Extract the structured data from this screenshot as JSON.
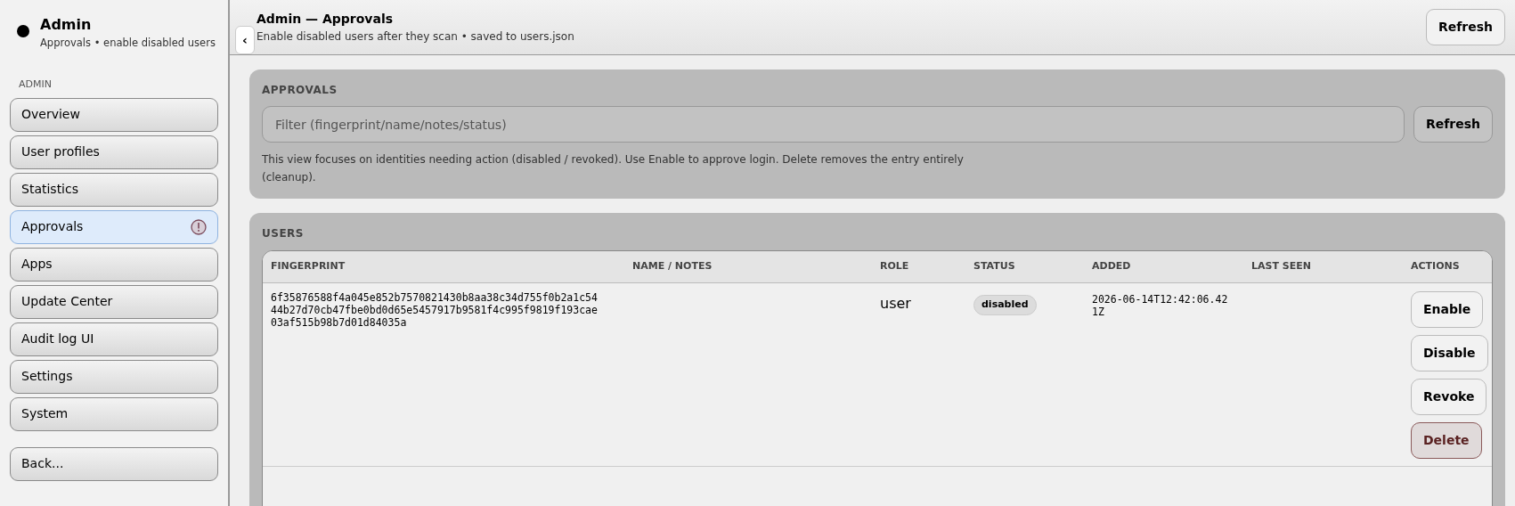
{
  "sidebar": {
    "title": "Admin",
    "subtitle": "Approvals • enable disabled users",
    "section": "ADMIN",
    "items": [
      {
        "label": "Overview",
        "selected": false,
        "alert": false
      },
      {
        "label": "User profiles",
        "selected": false,
        "alert": false
      },
      {
        "label": "Statistics",
        "selected": false,
        "alert": false
      },
      {
        "label": "Approvals",
        "selected": true,
        "alert": true
      },
      {
        "label": "Apps",
        "selected": false,
        "alert": false
      },
      {
        "label": "Update Center",
        "selected": false,
        "alert": false
      },
      {
        "label": "Audit log UI",
        "selected": false,
        "alert": false
      },
      {
        "label": "Settings",
        "selected": false,
        "alert": false
      },
      {
        "label": "System",
        "selected": false,
        "alert": false
      }
    ],
    "back": "Back...",
    "collapse": "‹"
  },
  "header": {
    "title": "Admin — Approvals",
    "subtitle": "Enable disabled users after they scan • saved to users.json",
    "refresh": "Refresh"
  },
  "approvals": {
    "title": "APPROVALS",
    "placeholder": "Filter (fingerprint/name/notes/status)",
    "refresh": "Refresh",
    "help": "This view focuses on identities needing action (disabled / revoked). Use Enable to approve login. Delete removes the entry entirely (cleanup)."
  },
  "users": {
    "title": "USERS",
    "columns": [
      "FINGERPRINT",
      "NAME / NOTES",
      "ROLE",
      "STATUS",
      "ADDED",
      "LAST SEEN",
      "ACTIONS"
    ],
    "rows": [
      {
        "fingerprint": "6f35876588f4a045e852b7570821430b8aa38c34d755f0b2a1c5444b27d70cb47fbe0bd0d65e5457917b9581f4c995f9819f193cae03af515b98b7d01d84035a",
        "role": "user",
        "status": "disabled",
        "added": "2026-06-14T12:42:06.421Z",
        "actions": [
          {
            "label": "Enable",
            "kind": "normal"
          },
          {
            "label": "Disable",
            "kind": "normal"
          },
          {
            "label": "Revoke",
            "kind": "normal"
          },
          {
            "label": "Delete",
            "kind": "danger"
          }
        ]
      }
    ]
  }
}
